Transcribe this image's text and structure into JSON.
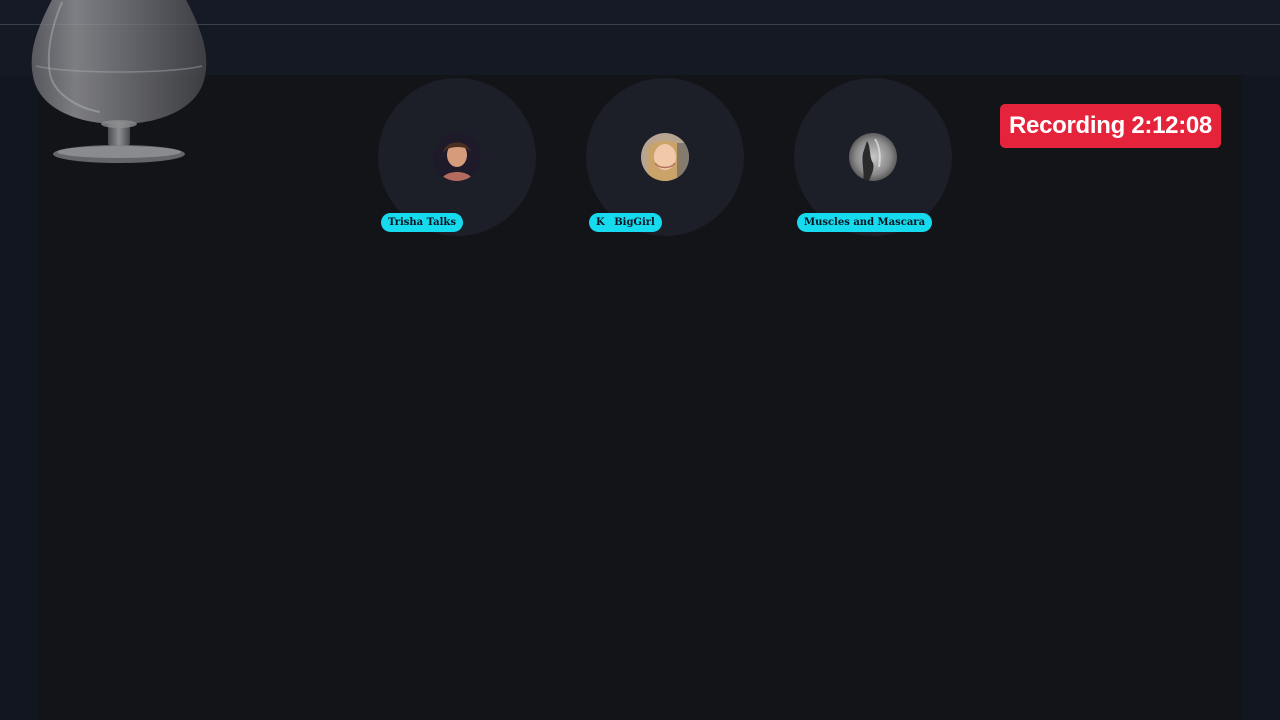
{
  "recording": {
    "label": "Recording 2:12:08"
  },
  "speakers": [
    {
      "name": "Trisha Talks",
      "prefix": ""
    },
    {
      "name": "BigGirl",
      "prefix": "K"
    },
    {
      "name": "Muscles and Mascara",
      "prefix": ""
    }
  ],
  "colors": {
    "background": "#131418",
    "speaker_disc": "#1c1f28",
    "name_tag": "#16dbee",
    "recording_badge": "#e5233a"
  },
  "icons": {
    "logo": "brandy-glass-icon"
  }
}
